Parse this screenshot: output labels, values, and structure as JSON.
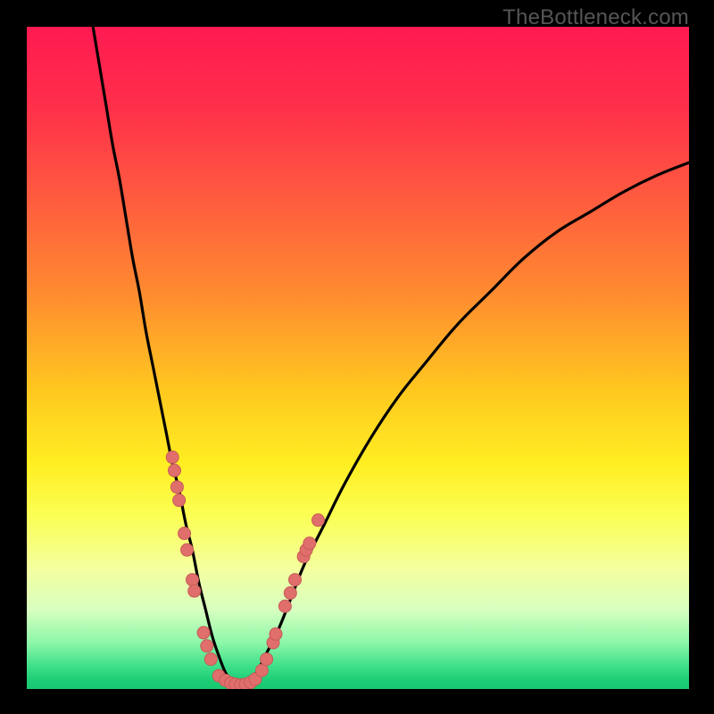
{
  "watermark": "TheBottleneck.com",
  "colors": {
    "black": "#000000",
    "curve": "#000000",
    "marker_fill": "#e06f6c",
    "marker_stroke": "#c75a57",
    "gradient_stops": [
      {
        "offset": 0.0,
        "color": "#ff1a52"
      },
      {
        "offset": 0.12,
        "color": "#ff2f4a"
      },
      {
        "offset": 0.25,
        "color": "#ff5840"
      },
      {
        "offset": 0.4,
        "color": "#ff8a30"
      },
      {
        "offset": 0.55,
        "color": "#ffc81f"
      },
      {
        "offset": 0.66,
        "color": "#ffee22"
      },
      {
        "offset": 0.74,
        "color": "#fbff55"
      },
      {
        "offset": 0.82,
        "color": "#f4ffa0"
      },
      {
        "offset": 0.88,
        "color": "#d8ffc0"
      },
      {
        "offset": 0.93,
        "color": "#8cf7a8"
      },
      {
        "offset": 0.965,
        "color": "#3fe08a"
      },
      {
        "offset": 0.985,
        "color": "#1fcf78"
      },
      {
        "offset": 1.0,
        "color": "#18c770"
      }
    ]
  },
  "chart_data": {
    "type": "line",
    "title": "",
    "xlabel": "",
    "ylabel": "",
    "xlim": [
      0,
      100
    ],
    "ylim": [
      0,
      100
    ],
    "grid": false,
    "series": [
      {
        "name": "bottleneck-curve",
        "x": [
          10,
          11,
          12,
          13,
          14,
          15,
          16,
          17,
          18,
          19,
          20,
          21,
          22,
          23,
          24,
          25,
          26,
          27,
          28,
          29,
          30,
          31,
          32,
          33,
          34,
          35,
          36,
          38,
          40,
          42,
          45,
          48,
          52,
          56,
          60,
          65,
          70,
          75,
          80,
          85,
          90,
          95,
          100
        ],
        "y": [
          100,
          94,
          88,
          82,
          77,
          71,
          65,
          60,
          54,
          49,
          44,
          39,
          34,
          30,
          25,
          21,
          16,
          12,
          8,
          5,
          2.5,
          1.2,
          0.6,
          0.6,
          1.5,
          3,
          5,
          9,
          14,
          19,
          25,
          31,
          38,
          44,
          49,
          55,
          60,
          65,
          69,
          72,
          75,
          77.5,
          79.5
        ]
      }
    ],
    "markers": [
      {
        "x": 22.0,
        "y": 35.0
      },
      {
        "x": 22.3,
        "y": 33.0
      },
      {
        "x": 22.7,
        "y": 30.5
      },
      {
        "x": 23.0,
        "y": 28.5
      },
      {
        "x": 23.8,
        "y": 23.5
      },
      {
        "x": 24.2,
        "y": 21.0
      },
      {
        "x": 25.0,
        "y": 16.5
      },
      {
        "x": 25.3,
        "y": 14.8
      },
      {
        "x": 26.7,
        "y": 8.5
      },
      {
        "x": 27.2,
        "y": 6.5
      },
      {
        "x": 27.8,
        "y": 4.5
      },
      {
        "x": 29.0,
        "y": 2.0
      },
      {
        "x": 30.0,
        "y": 1.3
      },
      {
        "x": 30.8,
        "y": 0.9
      },
      {
        "x": 31.5,
        "y": 0.7
      },
      {
        "x": 32.3,
        "y": 0.6
      },
      {
        "x": 33.0,
        "y": 0.7
      },
      {
        "x": 33.8,
        "y": 1.0
      },
      {
        "x": 34.5,
        "y": 1.5
      },
      {
        "x": 35.5,
        "y": 2.8
      },
      {
        "x": 36.2,
        "y": 4.5
      },
      {
        "x": 37.2,
        "y": 7.0
      },
      {
        "x": 37.6,
        "y": 8.3
      },
      {
        "x": 39.0,
        "y": 12.5
      },
      {
        "x": 39.8,
        "y": 14.5
      },
      {
        "x": 40.5,
        "y": 16.5
      },
      {
        "x": 41.8,
        "y": 20.0
      },
      {
        "x": 42.2,
        "y": 21.0
      },
      {
        "x": 42.7,
        "y": 22.0
      },
      {
        "x": 44.0,
        "y": 25.5
      }
    ]
  }
}
